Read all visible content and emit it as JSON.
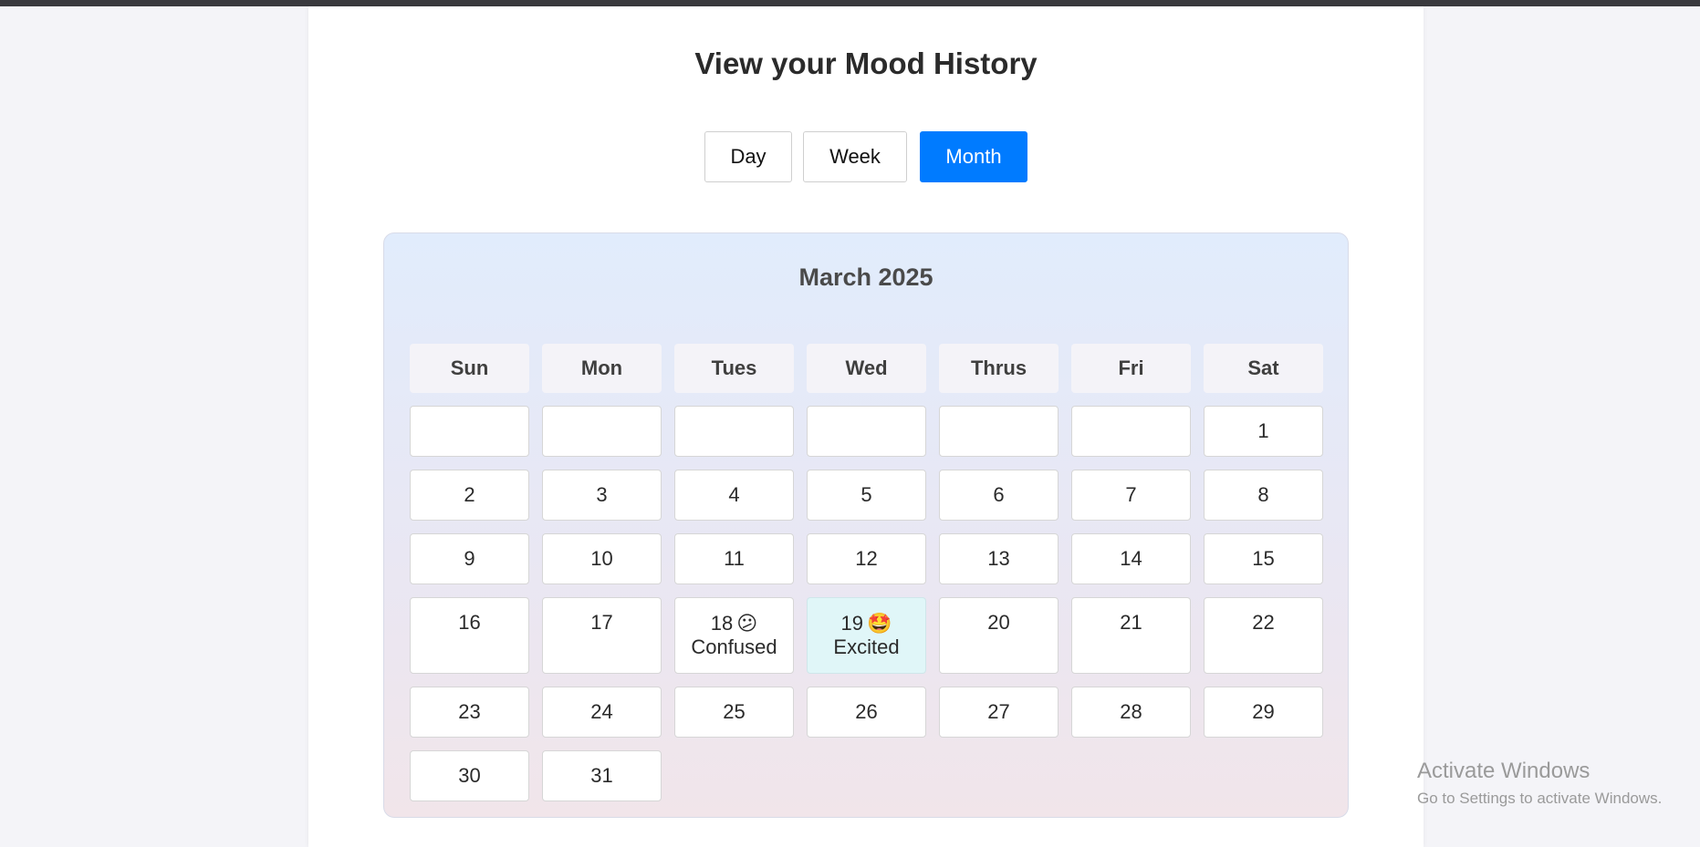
{
  "page": {
    "title": "View your Mood History"
  },
  "view_toggle": {
    "options": [
      "Day",
      "Week",
      "Month"
    ],
    "selected": "Month",
    "accent_color": "#007bff"
  },
  "calendar": {
    "month_label": "March 2025",
    "weekday_headers": [
      "Sun",
      "Mon",
      "Tues",
      "Wed",
      "Thrus",
      "Fri",
      "Sat"
    ],
    "leading_blank_days": 6,
    "days": [
      {
        "day": "1"
      },
      {
        "day": "2"
      },
      {
        "day": "3"
      },
      {
        "day": "4"
      },
      {
        "day": "5"
      },
      {
        "day": "6"
      },
      {
        "day": "7"
      },
      {
        "day": "8"
      },
      {
        "day": "9"
      },
      {
        "day": "10"
      },
      {
        "day": "11"
      },
      {
        "day": "12"
      },
      {
        "day": "13"
      },
      {
        "day": "14"
      },
      {
        "day": "15"
      },
      {
        "day": "16"
      },
      {
        "day": "17"
      },
      {
        "day": "18",
        "emoji": "😕",
        "mood": "Confused"
      },
      {
        "day": "19",
        "emoji": "🤩",
        "mood": "Excited",
        "highlighted": true
      },
      {
        "day": "20"
      },
      {
        "day": "21"
      },
      {
        "day": "22"
      },
      {
        "day": "23"
      },
      {
        "day": "24"
      },
      {
        "day": "25"
      },
      {
        "day": "26"
      },
      {
        "day": "27"
      },
      {
        "day": "28"
      },
      {
        "day": "29"
      },
      {
        "day": "30"
      },
      {
        "day": "31"
      }
    ]
  },
  "os_watermark": {
    "line1": "Activate Windows",
    "line2": "Go to Settings to activate Windows."
  }
}
